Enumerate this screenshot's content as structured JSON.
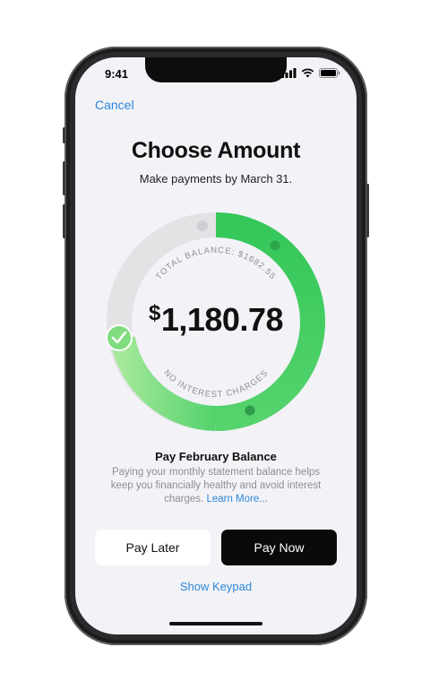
{
  "status_bar": {
    "time": "9:41"
  },
  "nav": {
    "cancel_label": "Cancel"
  },
  "header": {
    "title": "Choose Amount",
    "subtitle": "Make payments by March 31."
  },
  "dial": {
    "amount_currency": "$",
    "amount_value": "1,180.78",
    "top_label": "TOTAL BALANCE: $1682.55",
    "bottom_label": "NO INTEREST CHARGES",
    "accent_green": "#34c759",
    "track_gray": "#e3e3e6"
  },
  "info": {
    "heading": "Pay February Balance",
    "description": "Paying your monthly statement balance helps keep you financially healthy and avoid interest charges.",
    "learn_more": "Learn More..."
  },
  "actions": {
    "pay_later": "Pay Later",
    "pay_now": "Pay Now",
    "show_keypad": "Show Keypad"
  }
}
